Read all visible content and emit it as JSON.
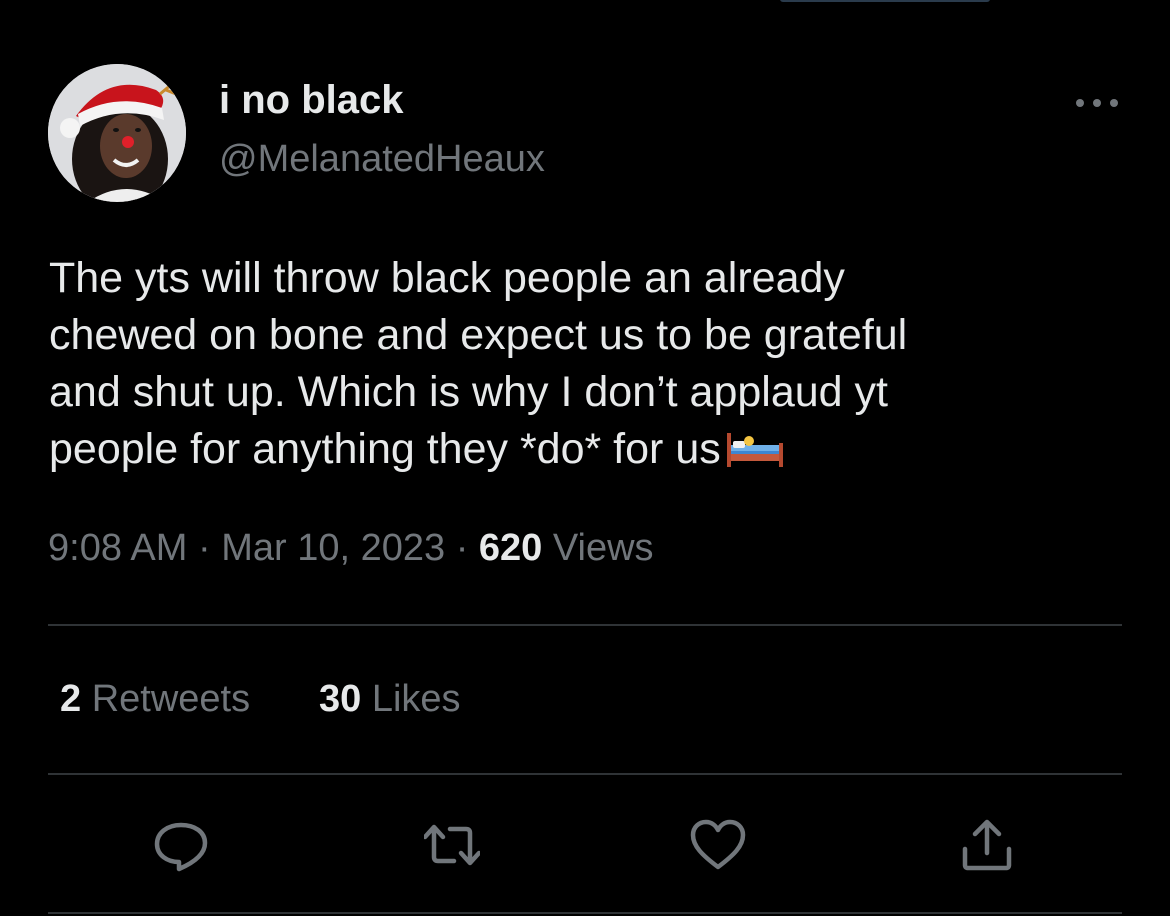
{
  "tweet": {
    "display_name": "i no black",
    "handle": "@MelanatedHeaux",
    "text": "The yts will throw black people an already\nchewed on bone and expect us to be grateful\nand shut up. Which is why I don’t applaud yt\npeople for anything they *do* for us",
    "emoji": "bed-emoji",
    "time": "9:08 AM",
    "separator": "·",
    "date": "Mar 10, 2023",
    "views_count": "620",
    "views_label": "Views"
  },
  "stats": {
    "retweets_count": "2",
    "retweets_label": "Retweets",
    "likes_count": "30",
    "likes_label": "Likes"
  },
  "actions": {
    "reply_icon": "reply-icon",
    "retweet_icon": "retweet-icon",
    "like_icon": "heart-icon",
    "share_icon": "share-icon"
  },
  "colors": {
    "background": "#000000",
    "primary_text": "#e7e9ea",
    "secondary_text": "#71767b",
    "divider": "#2f3336"
  }
}
